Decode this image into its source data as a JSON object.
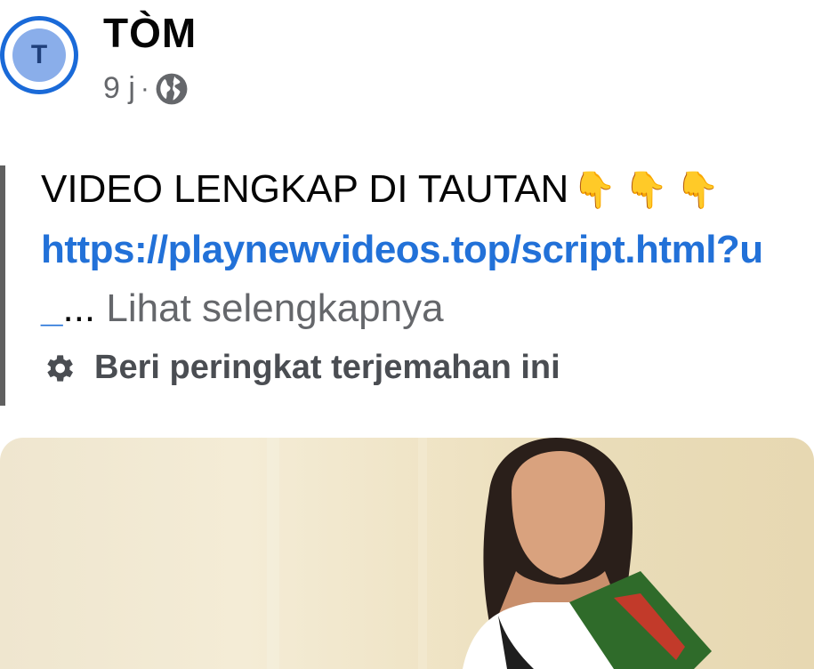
{
  "post": {
    "author": {
      "name": "TÒM",
      "avatar_initial": "T",
      "time": "9 j",
      "separator": "·",
      "audience_icon": "globe-icon"
    },
    "text": {
      "headline": "VIDEO LENGKAP DI TAUTAN",
      "emojis": [
        "👇",
        "👇",
        "👇"
      ],
      "link": "https://playnewvideos.top/script.html?u",
      "link_trail": "_",
      "ellipsis": "...",
      "see_more": "Lihat selengkapnya"
    },
    "translation": {
      "icon": "gear-icon",
      "label": "Beri peringkat terjemahan ini"
    },
    "media": {
      "type": "video-thumbnail"
    }
  },
  "colors": {
    "link": "#2271d8",
    "avatar_ring": "#1a6ad8",
    "secondary_text": "#65676b"
  }
}
